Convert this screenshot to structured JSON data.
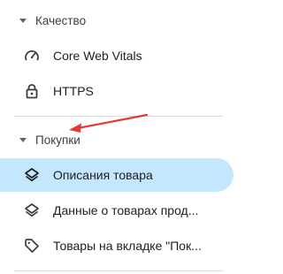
{
  "sections": [
    {
      "label": "Качество",
      "items": [
        {
          "label": "Core Web Vitals",
          "icon": "speedometer-icon"
        },
        {
          "label": "HTTPS",
          "icon": "lock-icon"
        }
      ]
    },
    {
      "label": "Покупки",
      "items": [
        {
          "label": "Описания товара",
          "icon": "layers-icon",
          "active": true
        },
        {
          "label": "Данные о товарах прод...",
          "icon": "layers-icon"
        },
        {
          "label": "Товары на вкладке \"Пок...",
          "icon": "tag-icon"
        }
      ]
    }
  ],
  "colors": {
    "active_bg": "#c2e7ff",
    "annotation_arrow": "#e53935",
    "divider": "#dadce0"
  }
}
